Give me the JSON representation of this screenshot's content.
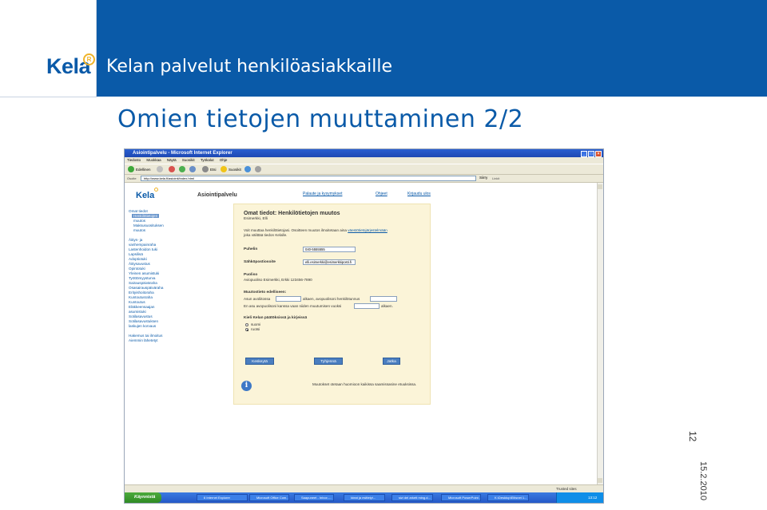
{
  "header": {
    "logo": "Kela",
    "title": "Kelan palvelut henkilöasiakkaille"
  },
  "slide": {
    "title": "Omien tietojen muuttaminen 2/2",
    "page_number": "12",
    "date": "15.2.2010"
  },
  "browser": {
    "window_title": "Asiointipalvelu - Microsoft Internet Explorer",
    "menu": [
      "Tiedosto",
      "Muokkaa",
      "Näytä",
      "Suosikit",
      "Työkalut",
      "Ohje"
    ],
    "toolbar": {
      "back": "Edellinen",
      "search": "Etsi",
      "favorites": "Suosikit"
    },
    "address_label": "Osoite",
    "address": "http://www.kela.fi/asiointi/index.html",
    "go_label": "Siirry",
    "links_label": "Linkit",
    "status_text": "Trusted sites"
  },
  "page": {
    "logo": "Kela",
    "service_name": "Asiointipalvelu",
    "top_links": [
      "Palaute ja kysymykset",
      "Ohjeet",
      "Kirjaudu ulos"
    ],
    "sidebar": {
      "items": [
        "Omat tiedot",
        "Henkilötietojen",
        "muutos",
        "Maksusuosituksen",
        "muutos",
        "Äitiys- ja",
        "vanhempainraha",
        "Lastenhoidon tuki",
        "Lapsilisä",
        "Adoptiotuki",
        "Äitiysavustus",
        "Opintotuki",
        "Yleinen asumistuki",
        "Työttömyysturva",
        "Sairauspäiväraha",
        "Osasairauspäiväraha",
        "Erityishoitoraha",
        "Kuntoutusraha",
        "Kuntoutus",
        "Eläkkeensaajan",
        "asumistuki",
        "Sotilasavustus",
        "Sotilasavustuksen",
        "laskujen korvaus",
        "Hakemus tai ilmoitus",
        "Aiemmin lähetetyt"
      ]
    },
    "form": {
      "title": "Omat tiedot: Henkilötietojen muutos",
      "subtitle": "Esimerkki, Elli",
      "intro_1": "Voit muuttaa henkilötietojasi. Osoitteen muutos ilmoitetaan aina",
      "intro_link": "väestötietojärjestelmään",
      "intro_2": "joka välittää tiedon Kelalle.",
      "phone_label": "Puhelin",
      "phone_value": "040-5555555",
      "email_label": "Sähköpostiosoite",
      "email_value": "elli.esimerkki@esimerkkiposti.fi",
      "spouse_label": "Puoliso",
      "spouse_value": "Aviopuoliso Esimerkki, Erkki 123456-7890",
      "change_label": "Muutostieto edelliseen:",
      "change_line_1a": "Asun avoliitossa",
      "change_line_1b": "alkaen, avopuolisoni henkilötunnus",
      "change_line_2a": "En asu avopuolisoni kanssa vaan niiden muutumisen vuoksi",
      "change_line_2b": "alkaen.",
      "language_label": "Kieli Kelan päätöksissä ja kirjeissä",
      "language_options": [
        "suomi",
        "ruotsi"
      ],
      "buttons": [
        "Keskeytä",
        "Tyhjennä",
        "Jatka"
      ],
      "save_note": "Muutokset otetaan huomioon kaikissa saamissasine etuuksissa."
    }
  },
  "taskbar": {
    "start": "Käynnistä",
    "items": [
      "6 Internet Explorer",
      "Microsoft Office Com...",
      "Saapuneet - Inbox -...",
      "Ideat ja esittelyt...",
      "sizi del arkett ming.d...",
      "Microsoft PowerPoint ...",
      "K:\\Desktop\\Eltisnet 1..."
    ],
    "clock": "13:12"
  },
  "colors": {
    "kela_blue": "#0a5aa8",
    "logo_accent": "#f0b429",
    "form_background": "#fbf4d8",
    "button_blue": "#4a7ec0"
  }
}
